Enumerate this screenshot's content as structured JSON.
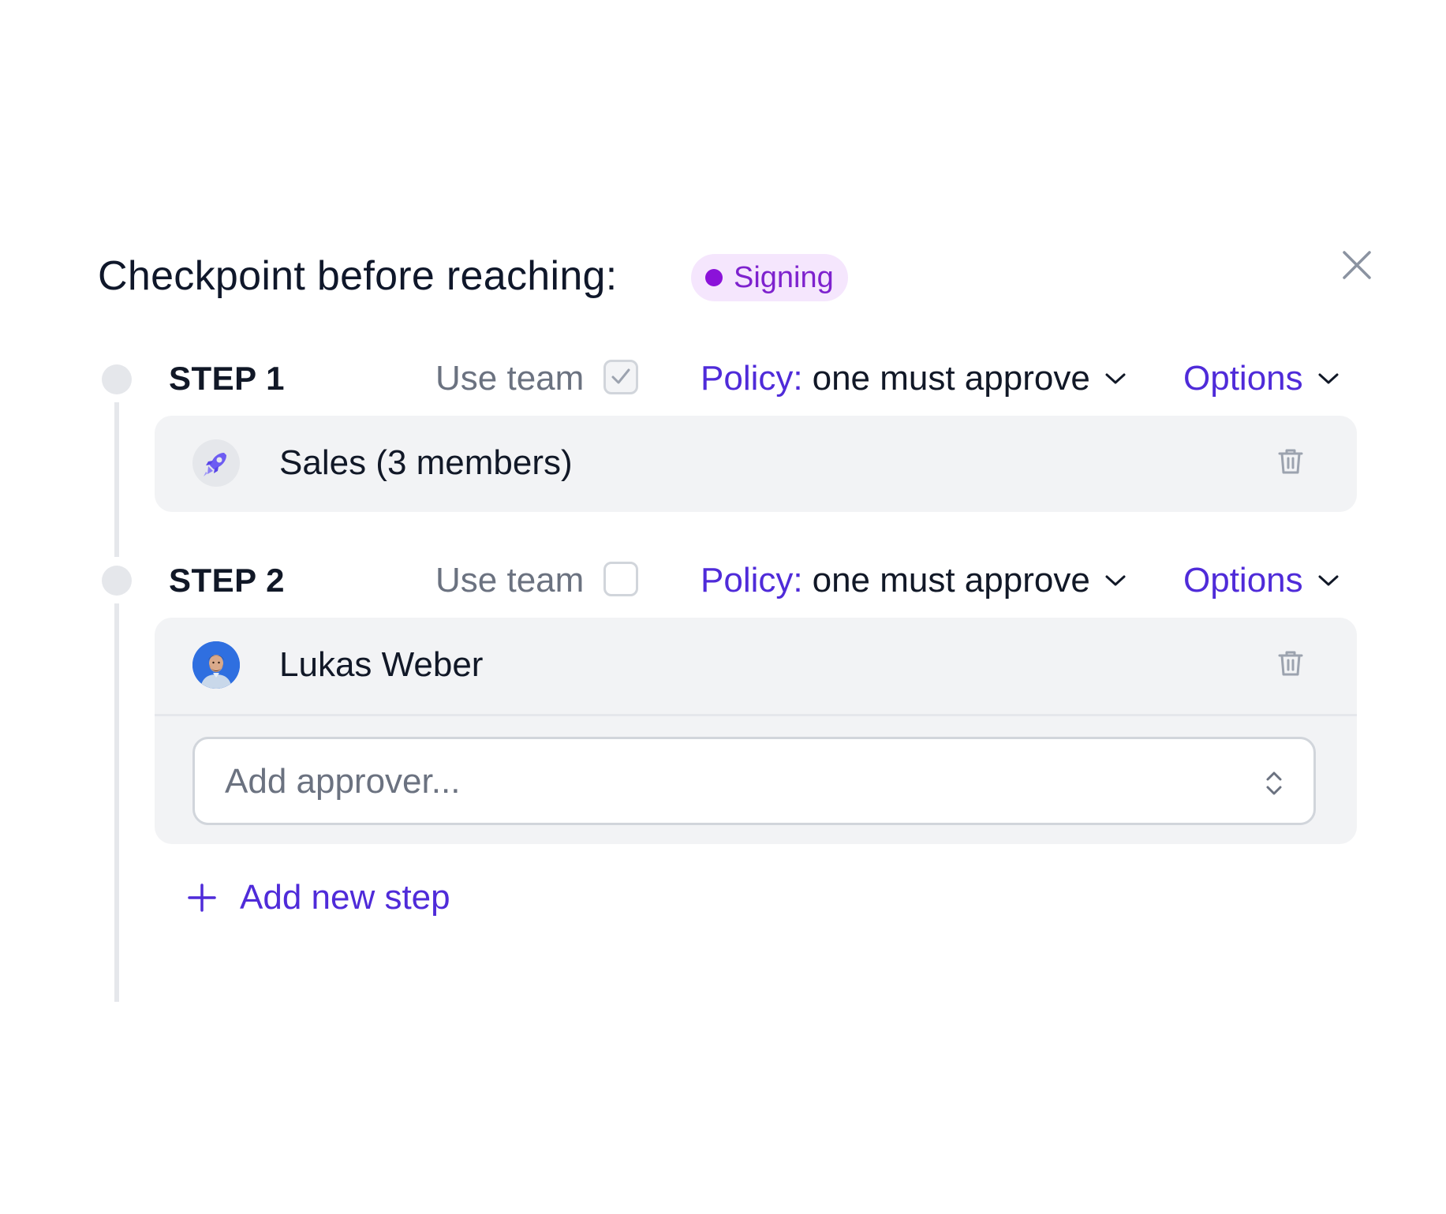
{
  "header": {
    "title": "Checkpoint before reaching:",
    "badge_label": "Signing"
  },
  "steps": [
    {
      "label": "STEP 1",
      "use_team_label": "Use team",
      "use_team_checked": true,
      "policy_label": "Policy:",
      "policy_value": "one must approve",
      "options_label": "Options",
      "approvers": [
        {
          "name": "Sales (3 members)",
          "avatar": "rocket-icon"
        }
      ]
    },
    {
      "label": "STEP 2",
      "use_team_label": "Use team",
      "use_team_checked": false,
      "policy_label": "Policy:",
      "policy_value": "one must approve",
      "options_label": "Options",
      "approvers": [
        {
          "name": "Lukas Weber",
          "avatar": "user-photo"
        }
      ],
      "add_approver_placeholder": "Add approver..."
    }
  ],
  "add_step_label": "Add new step",
  "colors": {
    "accent": "#4f2bd9",
    "badge_bg": "#f5e6fd",
    "badge_text": "#7e22ce",
    "card_bg": "#f2f3f5",
    "timeline": "#e5e7eb"
  },
  "icons": {
    "close": "close-icon",
    "trash": "trash-icon",
    "chevron": "chevron-down-icon",
    "checkmark": "check-icon",
    "sort": "chevron-up-down-icon",
    "plus": "plus-icon"
  }
}
